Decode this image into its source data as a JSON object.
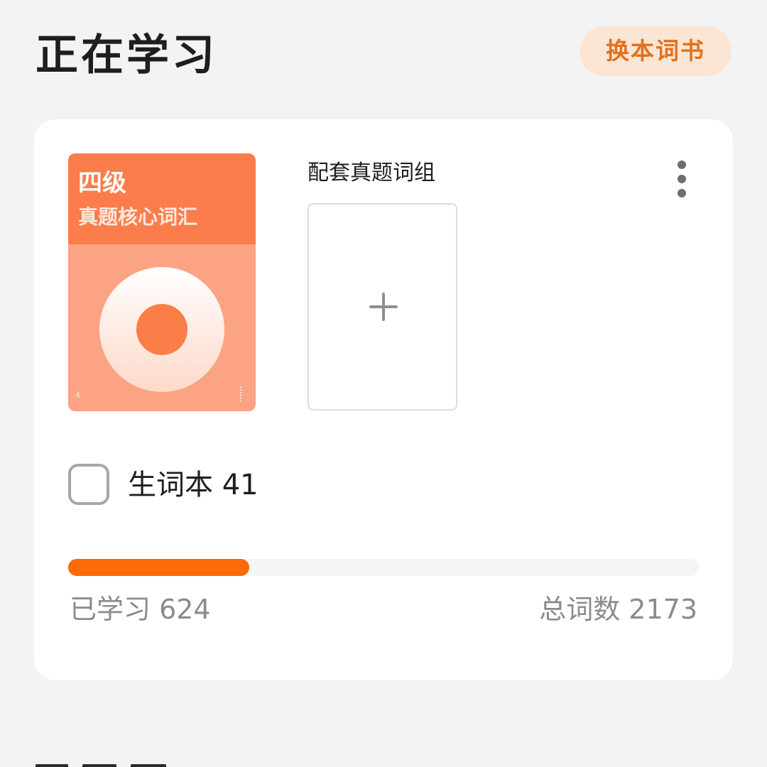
{
  "header": {
    "title": "正在学习",
    "switch_book_label": "换本词书"
  },
  "book": {
    "cover": {
      "level": "四级",
      "subtitle": "真题核心词汇",
      "corner_left": "4",
      "accent_color": "#fb7d4c",
      "background_color": "#fba382"
    },
    "group_label": "配套真题词组",
    "add_icon": "plus-icon",
    "more_icon": "more-vertical-icon"
  },
  "vocab_notebook": {
    "label": "生词本 41",
    "checked": false
  },
  "progress": {
    "learned_text": "已学习 624",
    "total_text": "总词数 2173",
    "learned": 624,
    "total": 2173,
    "fill_color": "#fd6a07"
  },
  "colors": {
    "page_background": "#f3f3f3",
    "accent": "#e2711b",
    "button_background": "#fbe6d6"
  }
}
